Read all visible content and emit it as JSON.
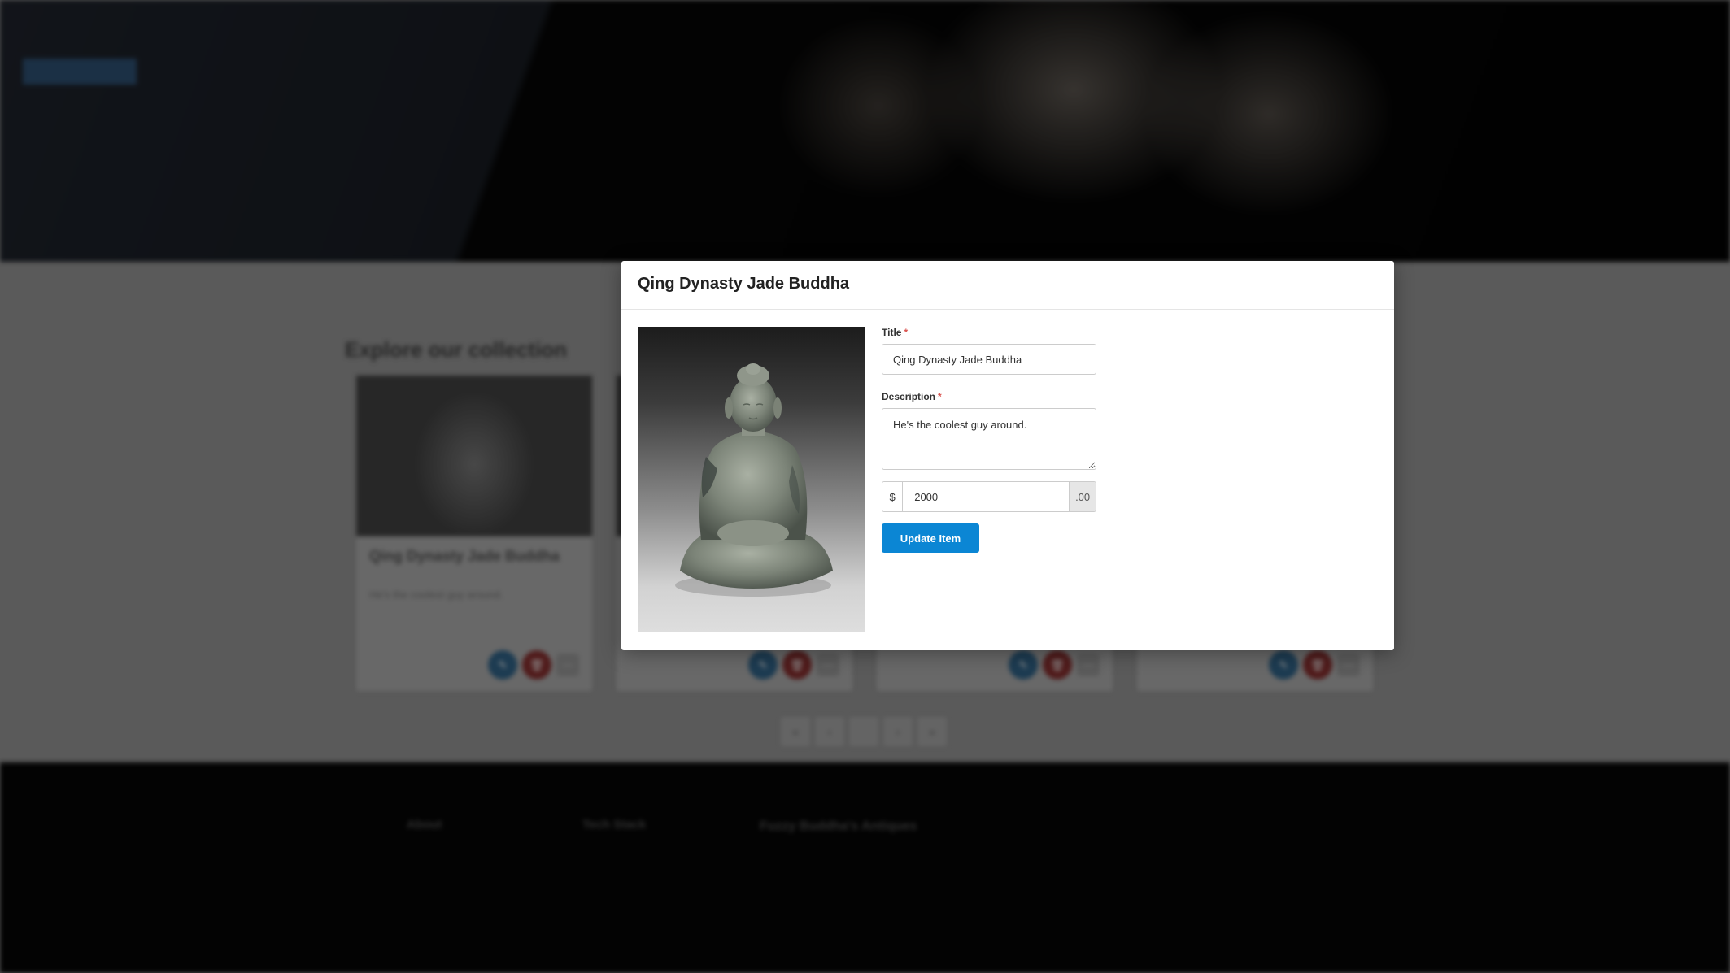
{
  "background": {
    "hero_caption": "",
    "hero_button": "",
    "section_title": "Explore our collection",
    "cards": [
      {
        "title": "Qing Dynasty Jade Buddha",
        "subtitle": "",
        "description": "He's the coolest guy around."
      },
      {
        "title": "",
        "subtitle": "",
        "description": ""
      },
      {
        "title": "",
        "subtitle": "",
        "description": ""
      },
      {
        "title": "",
        "subtitle": "",
        "description": ""
      }
    ],
    "footer": {
      "col1_heading": "About",
      "col2_heading": "Tech Stack",
      "brand": "Fuzzy Buddha's Antiques",
      "text1": "",
      "text2": ""
    }
  },
  "modal": {
    "title": "Qing Dynasty Jade Buddha",
    "form": {
      "title_label": "Title",
      "title_value": "Qing Dynasty Jade Buddha",
      "description_label": "Description",
      "description_value": "He's the coolest guy around.",
      "price_prefix": "$",
      "price_value": "2000",
      "price_suffix": ".00",
      "required_marker": "*"
    },
    "update_button": "Update Item"
  },
  "colors": {
    "accent": "#0b86d4",
    "required": "#d9534f"
  },
  "icons": {
    "edit": "pencil-icon",
    "delete": "trash-icon",
    "more": "ellipsis-icon"
  }
}
